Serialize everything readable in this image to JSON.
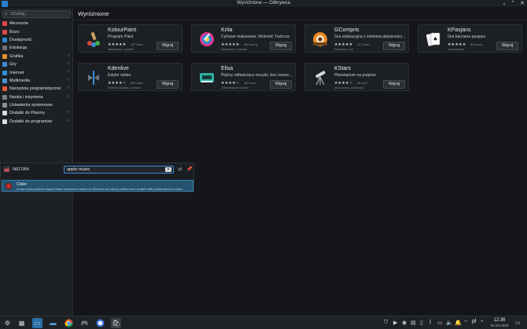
{
  "window": {
    "title": "Wyróżnione — Odkrywca"
  },
  "sidebar": {
    "search_placeholder": "Szukaj...",
    "categories": [
      {
        "label": "Akcesoria",
        "color": "#e0454d",
        "chevron": false
      },
      {
        "label": "Biuro",
        "color": "#d84a4a",
        "chevron": false
      },
      {
        "label": "Dostępność",
        "color": "#2e87d6",
        "chevron": false
      },
      {
        "label": "Edukacja",
        "color": "#6d6f74",
        "chevron": false
      },
      {
        "label": "Grafika",
        "color": "#e2902f",
        "chevron": true
      },
      {
        "label": "Gry",
        "color": "#3a8bd0",
        "chevron": true
      },
      {
        "label": "Internet",
        "color": "#2f8fd8",
        "chevron": true
      },
      {
        "label": "Multimedia",
        "color": "#4a95d6",
        "chevron": true
      },
      {
        "label": "Narzędzia programistyczne",
        "color": "#e05a2f",
        "chevron": true
      },
      {
        "label": "Nauka i inżynieria",
        "color": "#7a7f86",
        "chevron": true
      },
      {
        "label": "Ustawienia systemowe",
        "color": "#8a9096",
        "chevron": false
      },
      {
        "label": "Dodatki do Plazmy",
        "color": "#d9dcdf",
        "chevron": true
      },
      {
        "label": "Dodatki do programów",
        "color": "#d9dcdf",
        "chevron": true
      }
    ]
  },
  "main": {
    "title": "Wyróżnione",
    "apps": [
      {
        "name": "KolourPaint",
        "desc": "Program Paint",
        "stars": "★★★★★",
        "reviews": "187 ocen",
        "sub": "Malowanie i rysunki",
        "install": "Wgraj"
      },
      {
        "name": "Krita",
        "desc": "Cyfrowe malowanie, Wolność Twórcza",
        "stars": "★★★★★",
        "reviews": "992 oceny",
        "sub": "Malowanie i rysunki",
        "install": "Wgraj"
      },
      {
        "name": "GCompris",
        "desc": "Gra edukacyjna z wieloma aktywności...",
        "stars": "★★★★★",
        "reviews": "147 ocen",
        "sub": "Edukacja, Gry",
        "install": "Wgraj"
      },
      {
        "name": "KPasjans",
        "desc": "Gra karciana pasjans",
        "stars": "★★★★★",
        "reviews": "83 oceny",
        "sub": "Gry karciane",
        "install": "Wgraj"
      },
      {
        "name": "Kdenlive",
        "desc": "Edytor wideo",
        "stars": "★★★★☆",
        "reviews": "830 ocen",
        "sub": "Edytory dźwięku i obrazu",
        "install": "Wgraj"
      },
      {
        "name": "Elisa",
        "desc": "Piękny odtwarzacz muzyki, bez nonse...",
        "stars": "★★★★☆",
        "reviews": "187 ocen",
        "sub": "Odtwarzacze muzyki",
        "install": "Wgraj"
      },
      {
        "name": "KStars",
        "desc": "Planetarium na pulpicie",
        "stars": "★★★★☆",
        "reviews": "26 ocen",
        "sub": "Astronomia, Edukacja",
        "install": "Wgraj"
      }
    ]
  },
  "runner": {
    "user": "N61TAN",
    "query": "apple music",
    "result_title": "Cider",
    "result_desc": "A new cross-platform Apple Music experience based on Electron and Vue.js written from scratch with performance in mind..."
  },
  "taskbar": {
    "keyboard_layout": "pl",
    "time": "12:36",
    "date": "01.04.2023"
  }
}
